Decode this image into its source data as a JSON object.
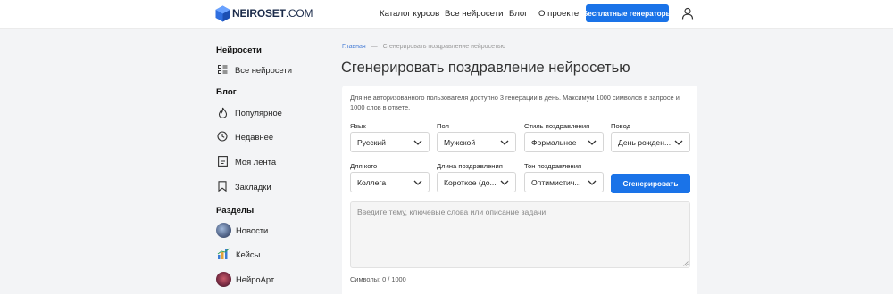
{
  "header": {
    "logo_brand": "NEIROSET",
    "logo_domain": ".COM",
    "nav": [
      "Каталог курсов",
      "Все нейросети",
      "Блог",
      "О проекте"
    ],
    "cta": "Бесплатные генераторы"
  },
  "sidebar": {
    "section_neural": "Нейросети",
    "all_neural": "Все нейросети",
    "section_blog": "Блог",
    "blog_items": [
      "Популярное",
      "Недавнее",
      "Моя лента",
      "Закладки"
    ],
    "section_parts": "Разделы",
    "parts": [
      "Новости",
      "Кейсы",
      "НейроАрт"
    ]
  },
  "main": {
    "breadcrumb_home": "Главная",
    "breadcrumb_sep": "—",
    "breadcrumb_current": "Сгенерировать поздравление нейросетью",
    "title": "Сгенерировать поздравление нейросетью",
    "notice": "Для не авторизованного пользователя доступно 3 генерации в день. Максимум 1000 символов в запросе и 1000 слов в ответе.",
    "fields": [
      {
        "label": "Язык",
        "value": "Русский"
      },
      {
        "label": "Пол",
        "value": "Мужской"
      },
      {
        "label": "Стиль поздравления",
        "value": "Формальное"
      },
      {
        "label": "Повод",
        "value": "День рожден..."
      },
      {
        "label": "Для кого",
        "value": "Коллега"
      },
      {
        "label": "Длина поздравления",
        "value": "Короткое (до..."
      },
      {
        "label": "Тон поздравления",
        "value": "Оптимистич..."
      }
    ],
    "generate_button": "Сгенерировать",
    "prompt_placeholder": "Введите тему, ключевые слова или описание задачи",
    "counter": "Символы: 0 / 1000"
  },
  "colors": {
    "accent": "#1a73e8",
    "page_bg": "#f3f4f6",
    "card_bg": "#ffffff"
  },
  "icons": {
    "logo": "cube-logo-icon",
    "user": "user-icon",
    "all_neural": "list-icon",
    "popular": "flame-icon",
    "recent": "clock-icon",
    "feed": "document-icon",
    "bookmarks": "bookmark-icon",
    "select": "chevron-down-icon"
  }
}
